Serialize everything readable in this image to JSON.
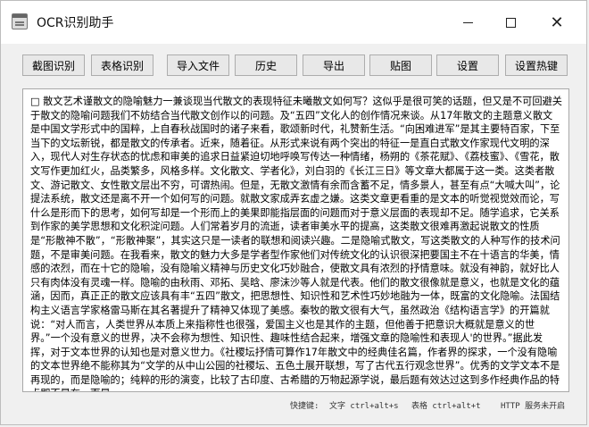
{
  "window": {
    "title": "OCR识别助手",
    "controls": {
      "minimize": "—",
      "maximize": "□",
      "close": "✕"
    }
  },
  "toolbar": {
    "buttons": [
      {
        "label": "截图识别"
      },
      {
        "label": "表格识别"
      },
      {
        "label": "导入文件"
      },
      {
        "label": "历史"
      },
      {
        "label": "导出"
      },
      {
        "label": "贴图"
      },
      {
        "label": "设置"
      },
      {
        "label": "设置热键"
      }
    ]
  },
  "document": {
    "text": "□ 散文艺术谨散文的隐喻魅力一兼谈现当代散文的表现特征未曦散文如何写？这似乎是很可笑的话题，但又是不可回避关于散文的隐喻问题我们不妨结合当代散文创作以的问题。及“五四”文化人的创作情况来谈。从17年散文的主题意义散文是中国文学形式中的国粹，上自春秋战国时的诸子来看，歌颂新时代，礼赞新生活。“向困难进军”是其主要特百家，下至当下的文坛新锐，都是散文的传承者。近来，随着征。从形式来说有两个突出的特征一是直白式散文作家现代文明的深入，现代人对生存状态的忧虑和审美的追求日益紧迫切地呼唤写传达一种情绪，杨朔的《茶花赋》、《荔枝蜜》、《雪花，散文写作更加红火，品类繁多，风格多样。文化散文、学者化》，刘白羽的《长江三日》等文章大都属于这一类。这类者散文、游记散文、女性散文层出不穷，可谓热闹。但是，无散文激情有余而含蓄不足，情多景人，甚至有点“大喊大叫”，论提法系统，散文还是离不开一个如何写的问题。就散文家成弄玄虚之嫌。这类文章更看重的是文本的听觉视觉效而论，写什么是形而下的思考，如何写却是一个形而上的美果即能指层面的问题而对于意义层面的表现却不足。随学追求，它关系到作家的美学思想和文化积淀问题。人们常着岁月的流逝，读者审美水平的提高，这类散文很难再激起说散文的性质是“形散神不散”，“形散神聚”，其实这只是一读者的联想和阅读兴趣。二是隐喻式散文，写这类散文的人种写作的技术问题，不是审美问题。在我看来，散文的魅力大多是学者型作家他们对传统文化的认识很深把要国主不在十语言的华美，情感的浓烈，而在十它的隐喻，没有隐喻义精神与历史文化巧妙融合，使散文具有浓烈的抒情意味。就没有神韵，就好比人只有肉体没有灵魂一样。隐喻的由秋雨、邓拓、吴晗、廖沫沙等人就是代表。他们的散文很像就是意义，也就是文化的蕴涵，因而，真正正的散文应该具有丰“五四”散文，把思想性、知识性和艺术性巧妙地融为一体，既富的文化隐喻。法国结构主义语言学家格雷马斯在其名著提升了精神又体现了美感。秦牧的散文很有大气，虽然政治《结构语言学》的开篇就说：“对人而言，人类世界从本质上来指称性也很强，爱国主义也是其作的主题，但他善于把意识大概就是意义的世界。”一个没有意义的世界，决不会称为想性、知识性、趣味性结合起来，增强文章的隐喻性和表现人'的世界。”据此发挥，对于文本世界的认知也是对意义世力。《社稷坛抒情可算作17年散文中的经典佳名篇，作者界的探求，一个没有隐喻的文本世界绝不能称其为“文学的从中山公园的社稷坛、五色土展开联想，写了古代五行观念世界”。优秀的文学文本不是再现的，而是隐喻的；纯粹的形的演变，比较了古印度、古希腊的万物起源学说，最后题有效达过这到多作经典作品的特点即不是在，而是"
  },
  "statusbar": {
    "shortcuts_label": "快捷键:",
    "text_shortcut": "文字 ctrl+alt+s",
    "table_shortcut": "表格 ctrl+alt+t",
    "http_status": "HTTP 服务未开启"
  }
}
